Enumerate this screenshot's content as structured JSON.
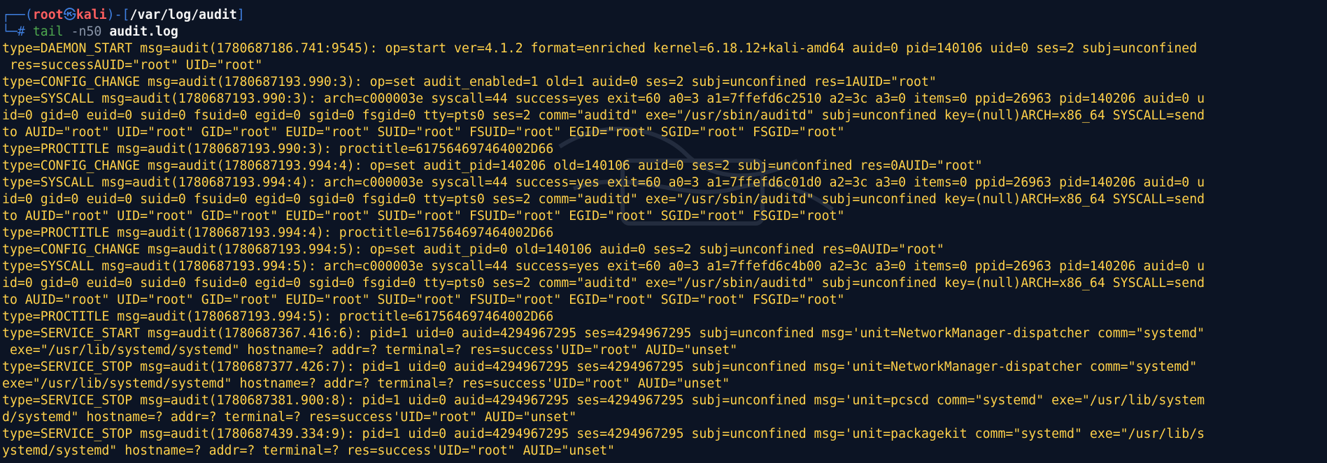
{
  "prompt": {
    "corner_top": "┌──(",
    "user": "root",
    "skull": "㉿",
    "host": "kali",
    "mid": ")-[",
    "path": "/var/log/audit",
    "end": "]",
    "corner_bottom": "└─",
    "symbol": "# ",
    "command": "tail",
    "option": " -n50 ",
    "argument": "audit.log"
  },
  "log_lines": [
    "type=DAEMON_START msg=audit(1780687186.741:9545): op=start ver=4.1.2 format=enriched kernel=6.18.12+kali-amd64 auid=0 pid=140106 uid=0 ses=2 subj=unconfined",
    " res=successAUID=\"root\" UID=\"root\"",
    "type=CONFIG_CHANGE msg=audit(1780687193.990:3): op=set audit_enabled=1 old=1 auid=0 ses=2 subj=unconfined res=1AUID=\"root\"",
    "type=SYSCALL msg=audit(1780687193.990:3): arch=c000003e syscall=44 success=yes exit=60 a0=3 a1=7ffefd6c2510 a2=3c a3=0 items=0 ppid=26963 pid=140206 auid=0 u",
    "id=0 gid=0 euid=0 suid=0 fsuid=0 egid=0 sgid=0 fsgid=0 tty=pts0 ses=2 comm=\"auditd\" exe=\"/usr/sbin/auditd\" subj=unconfined key=(null)ARCH=x86_64 SYSCALL=send",
    "to AUID=\"root\" UID=\"root\" GID=\"root\" EUID=\"root\" SUID=\"root\" FSUID=\"root\" EGID=\"root\" SGID=\"root\" FSGID=\"root\"",
    "type=PROCTITLE msg=audit(1780687193.990:3): proctitle=617564697464002D66",
    "type=CONFIG_CHANGE msg=audit(1780687193.994:4): op=set audit_pid=140206 old=140106 auid=0 ses=2 subj=unconfined res=0AUID=\"root\"",
    "type=SYSCALL msg=audit(1780687193.994:4): arch=c000003e syscall=44 success=yes exit=60 a0=3 a1=7ffefd6c01d0 a2=3c a3=0 items=0 ppid=26963 pid=140206 auid=0 u",
    "id=0 gid=0 euid=0 suid=0 fsuid=0 egid=0 sgid=0 fsgid=0 tty=pts0 ses=2 comm=\"auditd\" exe=\"/usr/sbin/auditd\" subj=unconfined key=(null)ARCH=x86_64 SYSCALL=send",
    "to AUID=\"root\" UID=\"root\" GID=\"root\" EUID=\"root\" SUID=\"root\" FSUID=\"root\" EGID=\"root\" SGID=\"root\" FSGID=\"root\"",
    "type=PROCTITLE msg=audit(1780687193.994:4): proctitle=617564697464002D66",
    "type=CONFIG_CHANGE msg=audit(1780687193.994:5): op=set audit_pid=0 old=140106 auid=0 ses=2 subj=unconfined res=0AUID=\"root\"",
    "type=SYSCALL msg=audit(1780687193.994:5): arch=c000003e syscall=44 success=yes exit=60 a0=3 a1=7ffefd6c4b00 a2=3c a3=0 items=0 ppid=26963 pid=140206 auid=0 u",
    "id=0 gid=0 euid=0 suid=0 fsuid=0 egid=0 sgid=0 fsgid=0 tty=pts0 ses=2 comm=\"auditd\" exe=\"/usr/sbin/auditd\" subj=unconfined key=(null)ARCH=x86_64 SYSCALL=send",
    "to AUID=\"root\" UID=\"root\" GID=\"root\" EUID=\"root\" SUID=\"root\" FSUID=\"root\" EGID=\"root\" SGID=\"root\" FSGID=\"root\"",
    "type=PROCTITLE msg=audit(1780687193.994:5): proctitle=617564697464002D66",
    "type=SERVICE_START msg=audit(1780687367.416:6): pid=1 uid=0 auid=4294967295 ses=4294967295 subj=unconfined msg='unit=NetworkManager-dispatcher comm=\"systemd\"",
    " exe=\"/usr/lib/systemd/systemd\" hostname=? addr=? terminal=? res=success'UID=\"root\" AUID=\"unset\"",
    "type=SERVICE_STOP msg=audit(1780687377.426:7): pid=1 uid=0 auid=4294967295 ses=4294967295 subj=unconfined msg='unit=NetworkManager-dispatcher comm=\"systemd\"",
    "exe=\"/usr/lib/systemd/systemd\" hostname=? addr=? terminal=? res=success'UID=\"root\" AUID=\"unset\"",
    "type=SERVICE_STOP msg=audit(1780687381.900:8): pid=1 uid=0 auid=4294967295 ses=4294967295 subj=unconfined msg='unit=pcscd comm=\"systemd\" exe=\"/usr/lib/system",
    "d/systemd\" hostname=? addr=? terminal=? res=success'UID=\"root\" AUID=\"unset\"",
    "type=SERVICE_STOP msg=audit(1780687439.334:9): pid=1 uid=0 auid=4294967295 ses=4294967295 subj=unconfined msg='unit=packagekit comm=\"systemd\" exe=\"/usr/lib/s",
    "ystemd/systemd\" hostname=? addr=? terminal=? res=success'UID=\"root\" AUID=\"unset\""
  ],
  "colors": {
    "background": "#0c1424",
    "log_text": "#ffd14a",
    "prompt_bracket": "#3f7fe0",
    "prompt_user_host": "#ff5f5f",
    "command": "#4ea84e"
  },
  "icons": {
    "watermark": "kali-dragon-logo-watermark"
  }
}
